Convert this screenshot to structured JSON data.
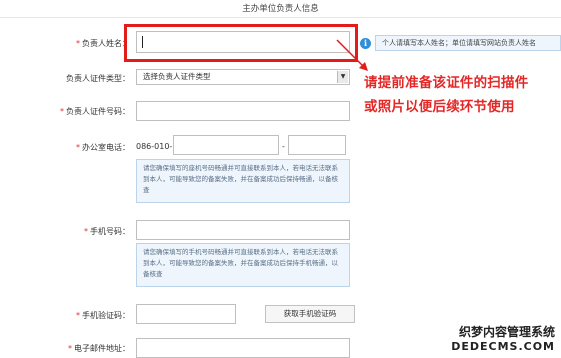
{
  "section_title": "主办单位负责人信息",
  "fields": {
    "name": {
      "label": "负责人姓名：",
      "required": "*",
      "value": ""
    },
    "id_type": {
      "label": "负责人证件类型：",
      "selected": "选择负责人证件类型"
    },
    "id_number": {
      "label": "负责人证件号码：",
      "required": "*",
      "value": ""
    },
    "office_phone": {
      "label": "办公室电话：",
      "required": "*",
      "prefix": "086-010-",
      "separator": "-",
      "note": "请您确保填写的座机号码畅通并可直接联系到本人，若电话无法联系到本人，可能导致您的备案失败，并在备案成功后保持畅通，以备核查"
    },
    "mobile": {
      "label": "手机号码：",
      "required": "*",
      "note": "请您确保填写的手机号码畅通并可直接联系到本人，若电话无法联系到本人，可能导致您的备案失败，并在备案成功后保持手机畅通，以备核查"
    },
    "sms_code": {
      "label": "手机验证码：",
      "required": "*",
      "button": "获取手机验证码"
    },
    "email": {
      "label": "电子邮件地址：",
      "required": "*"
    }
  },
  "hint": {
    "icon": "info-icon",
    "text": "个人请填写本人姓名；单位请填写网站负责人姓名"
  },
  "annotation": {
    "line1": "请提前准备该证件的扫描件",
    "line2": "或照片以便后续环节使用",
    "color": "#e32727"
  },
  "watermark": {
    "line1": "织梦内容管理系统",
    "line2": "DEDECMS.COM"
  },
  "colors": {
    "required": "#e03030",
    "highlight": "#e21b1b",
    "note_bg": "#eef5fc",
    "info_icon": "#2f8fd8"
  }
}
